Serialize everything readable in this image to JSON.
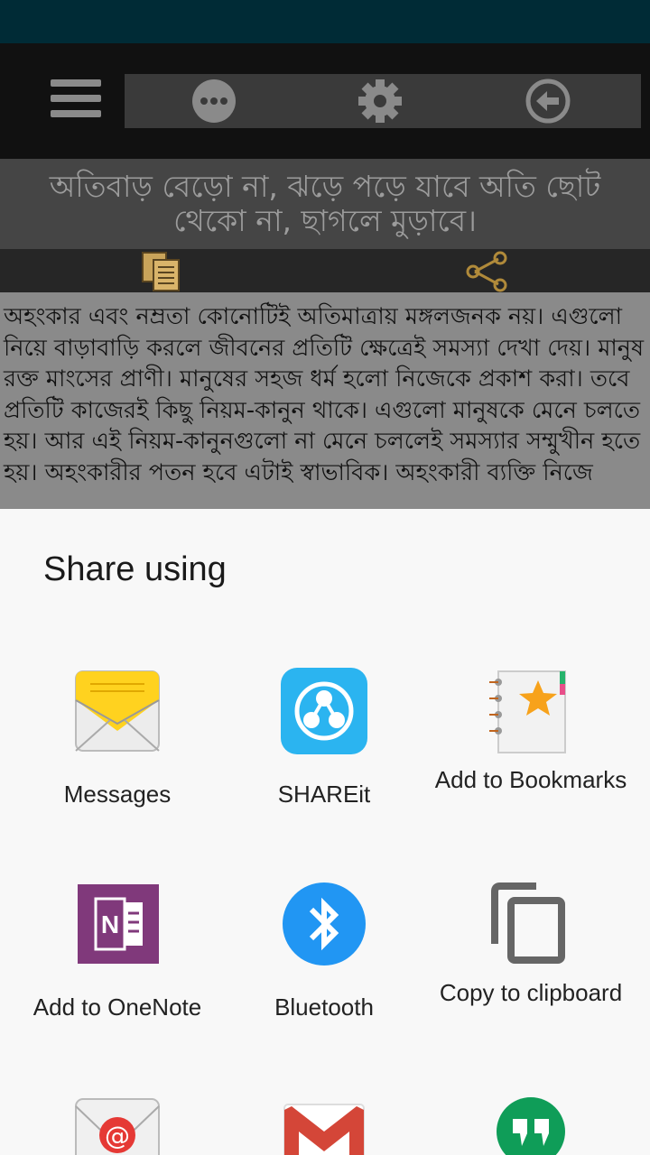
{
  "header": {
    "menu_icon": "hamburger-menu-icon",
    "more_icon": "more-dots-icon",
    "settings_icon": "gear-icon",
    "back_icon": "back-arrow-icon"
  },
  "quote": {
    "text": "অতিবাড় বেড়ো না, ঝড়ে পড়ে যাবে অতি ছোট থেকো না, ছাগলে মুড়াবে।"
  },
  "actions": {
    "copy_icon": "copy-icon",
    "share_icon": "share-icon"
  },
  "content": {
    "text": " অহংকার এবং নম্রতা কোনোটিই অতিমাত্রায় মঙ্গলজনক নয়। এগুলো নিয়ে বাড়াবাড়ি করলে জীবনের প্রতিটি ক্ষেত্রেই সমস্যা দেখা দেয়। মানুষ রক্ত মাংসের প্রাণী। মানুষের সহজ ধর্ম হলো নিজেকে প্রকাশ করা। তবে প্রতিটি কাজেরই কিছু নিয়ম-কানুন থাকে। এগুলো মানুষকে মেনে চলতে হয়। আর এই নিয়ম-কানুনগুলো না মেনে চললেই সমস্যার সম্মুখীন হতে হয়। অহংকারীর পতন হবে এটাই স্বাভাবিক। অহংকারী ব্যক্তি নিজে"
  },
  "share_sheet": {
    "title": "Share using",
    "apps": [
      {
        "label": "Messages",
        "icon": "messages-icon"
      },
      {
        "label": "SHAREit",
        "icon": "shareit-icon"
      },
      {
        "label": "Add to Bookmarks",
        "icon": "bookmarks-icon"
      },
      {
        "label": "Add to OneNote",
        "icon": "onenote-icon"
      },
      {
        "label": "Bluetooth",
        "icon": "bluetooth-icon"
      },
      {
        "label": "Copy to clipboard",
        "icon": "clipboard-icon"
      },
      {
        "label": "",
        "icon": "email-icon"
      },
      {
        "label": "",
        "icon": "gmail-icon"
      },
      {
        "label": "",
        "icon": "hangouts-icon"
      }
    ]
  },
  "colors": {
    "status_bar": "#002b36",
    "shareit_blue": "#2bb4f0",
    "onenote_purple": "#80397b",
    "bluetooth_blue": "#2196f3",
    "gmail_red": "#d44638",
    "hangouts_green": "#0f9d58",
    "bookmark_star": "#f7a21b"
  }
}
